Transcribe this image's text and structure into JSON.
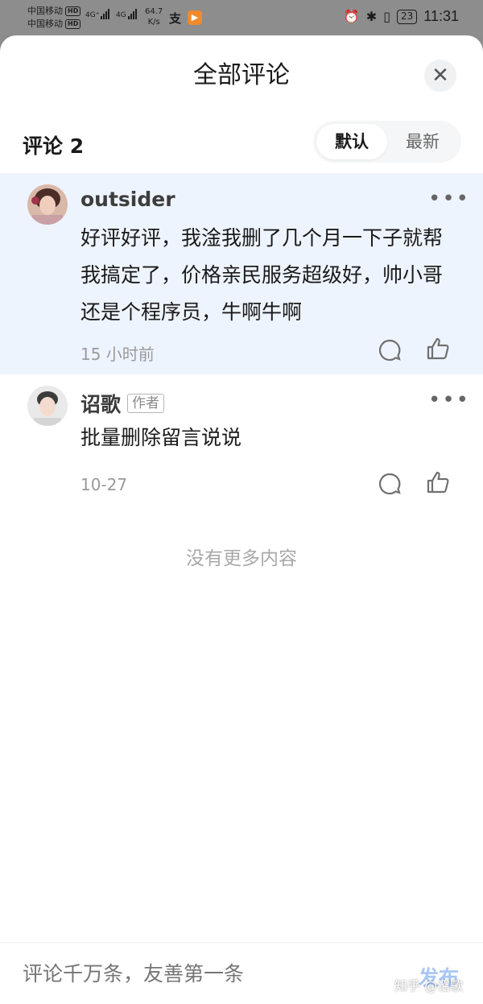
{
  "status_bar": {
    "carrier1": "中国移动",
    "carrier2": "中国移动",
    "hd": "HD",
    "net1": "4G⁺",
    "net2": "4G",
    "speed_value": "64.7",
    "speed_unit": "K/s",
    "app_icon1": "支",
    "battery": "23",
    "time": "11:31"
  },
  "sheet": {
    "title": "全部评论",
    "close_label": "✕",
    "count_label": "评论 2",
    "sort_options": [
      "默认",
      "最新"
    ],
    "sort_selected": "默认"
  },
  "comments": [
    {
      "author": "outsider",
      "badge": "",
      "text": "好评好评，我淦我删了几个月一下子就帮我搞定了，价格亲民服务超级好，帅小哥还是个程序员，牛啊牛啊",
      "time": "15 小时前",
      "highlighted": true
    },
    {
      "author": "诏歌",
      "badge": "作者",
      "text": "批量删除留言说说",
      "time": "10-27",
      "highlighted": false
    }
  ],
  "no_more": "没有更多内容",
  "composer": {
    "placeholder": "评论千万条，友善第一条",
    "publish_label": "发布"
  },
  "watermark": "知乎 @诏歌",
  "colors": {
    "accent_light": "#a9c7f4",
    "highlight_bg": "#eef4fe",
    "status_bar_bg": "#8d8d8d"
  },
  "icons": {
    "comment": "comment-bubble-icon",
    "like": "thumbs-up-icon",
    "more": "more-dots-icon",
    "close": "close-icon"
  }
}
